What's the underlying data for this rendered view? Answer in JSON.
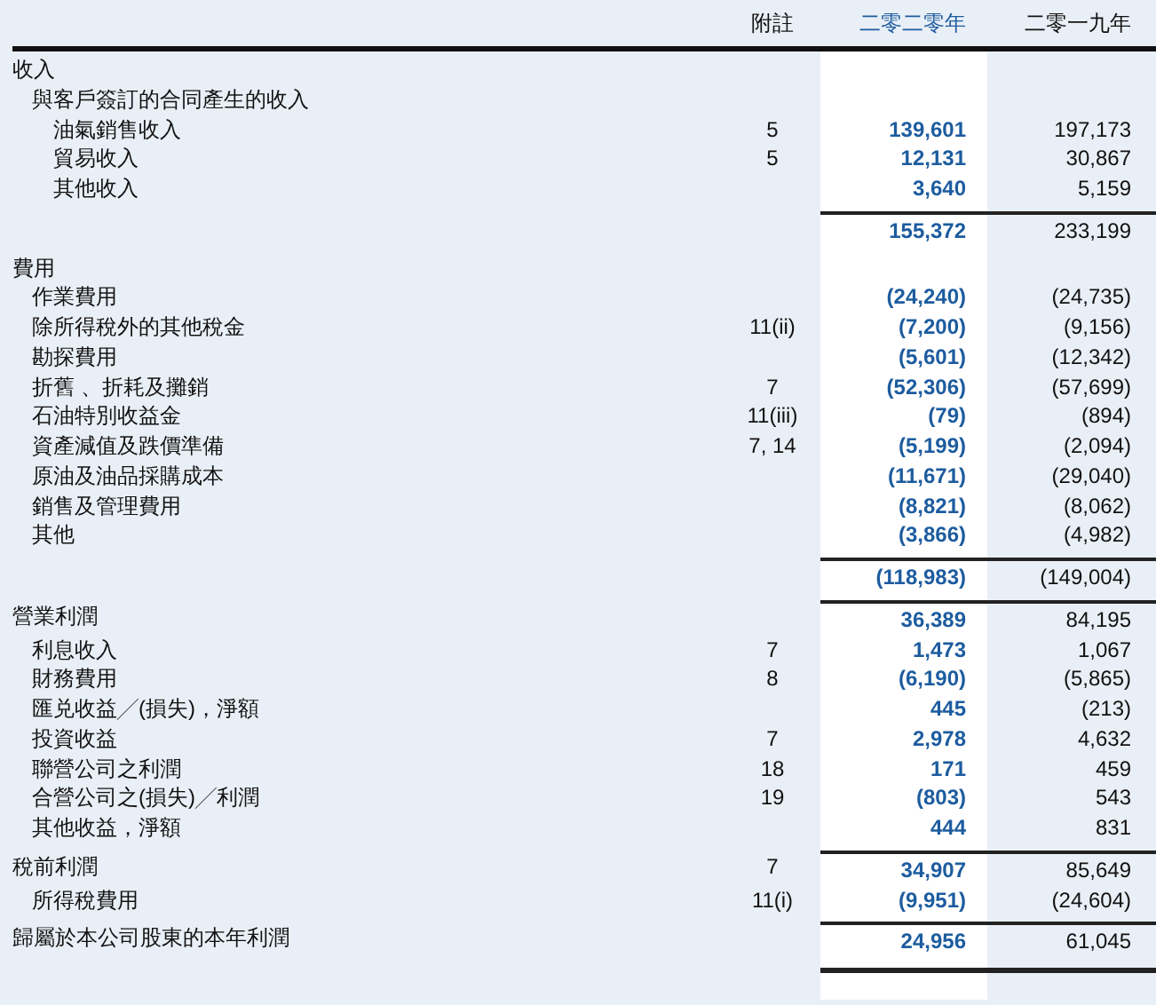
{
  "columns": {
    "note": "附註",
    "current": "二零二零年",
    "prior": "二零一九年"
  },
  "rows": [
    {
      "kind": "heading",
      "label": "收入",
      "children": [
        {
          "label": "與客戶簽訂的合同產生的收入",
          "children": [
            {
              "label": "油氣銷售收入",
              "note": "5",
              "current": "139,601",
              "prior": "197,173"
            },
            {
              "label": "貿易收入",
              "note": "5",
              "current": "12,131",
              "prior": "30,867"
            },
            {
              "label": "其他收入",
              "current": "3,640",
              "prior": "5,159"
            }
          ]
        }
      ]
    },
    {
      "kind": "total",
      "current": "155,372",
      "prior": "233,199"
    },
    {
      "kind": "heading",
      "label": "費用",
      "children": [
        {
          "label": "作業費用",
          "current": "(24,240)",
          "prior": "(24,735)"
        },
        {
          "label": "除所得稅外的其他稅金",
          "note": "11(ii)",
          "current": "(7,200)",
          "prior": "(9,156)"
        },
        {
          "label": "勘探費用",
          "current": "(5,601)",
          "prior": "(12,342)"
        },
        {
          "label": "折舊 、折耗及攤銷",
          "note": "7",
          "current": "(52,306)",
          "prior": "(57,699)"
        },
        {
          "label": "石油特別收益金",
          "note": "11(iii)",
          "current": "(79)",
          "prior": "(894)"
        },
        {
          "label": "資產減值及跌價準備",
          "note": "7, 14",
          "current": "(5,199)",
          "prior": "(2,094)"
        },
        {
          "label": "原油及油品採購成本",
          "current": "(11,671)",
          "prior": "(29,040)"
        },
        {
          "label": "銷售及管理費用",
          "current": "(8,821)",
          "prior": "(8,062)"
        },
        {
          "label": "其他",
          "current": "(3,866)",
          "prior": "(4,982)"
        }
      ]
    },
    {
      "kind": "total",
      "current": "(118,983)",
      "prior": "(149,004)"
    },
    {
      "kind": "result",
      "label": "營業利潤",
      "current": "36,389",
      "prior": "84,195",
      "children": [
        {
          "label": "利息收入",
          "note": "7",
          "current": "1,473",
          "prior": "1,067"
        },
        {
          "label": "財務費用",
          "note": "8",
          "current": "(6,190)",
          "prior": "(5,865)"
        },
        {
          "label": "匯兑收益╱(損失)，淨額",
          "current": "445",
          "prior": "(213)"
        },
        {
          "label": "投資收益",
          "note": "7",
          "current": "2,978",
          "prior": "4,632"
        },
        {
          "label": "聯營公司之利潤",
          "note": "18",
          "current": "171",
          "prior": "459"
        },
        {
          "label": "合營公司之(損失)╱利潤",
          "note": "19",
          "current": "(803)",
          "prior": "543"
        },
        {
          "label": "其他收益，淨額",
          "current": "444",
          "prior": "831"
        }
      ]
    },
    {
      "kind": "result",
      "label": "稅前利潤",
      "note": "7",
      "current": "34,907",
      "prior": "85,649",
      "children": [
        {
          "label": "所得稅費用",
          "note": "11(i)",
          "current": "(9,951)",
          "prior": "(24,604)"
        }
      ]
    },
    {
      "kind": "final",
      "label": "歸屬於本公司股東的本年利潤",
      "current": "24,956",
      "prior": "61,045"
    }
  ]
}
